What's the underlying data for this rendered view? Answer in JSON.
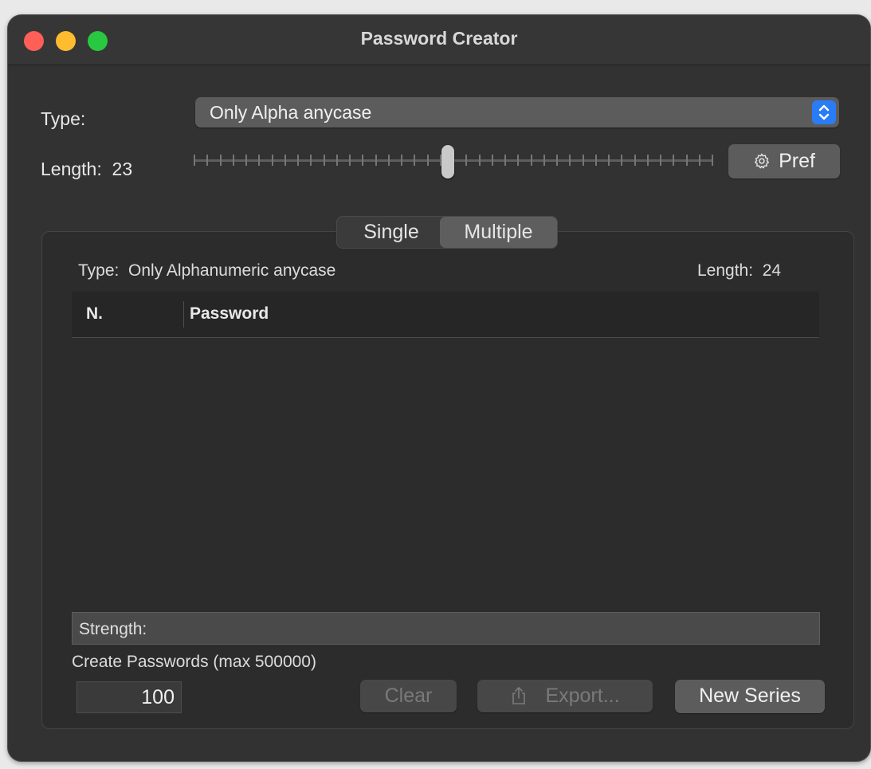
{
  "window": {
    "title": "Password Creator"
  },
  "top": {
    "type_label": "Type:",
    "type_value": "Only Alpha anycase",
    "length_label": "Length:",
    "length_value": "23",
    "pref_button": "Pref"
  },
  "tabs": {
    "single": "Single",
    "multiple": "Multiple",
    "selected": "Multiple"
  },
  "panel": {
    "type_label": "Type:",
    "type_value": "Only Alphanumeric anycase",
    "length_label": "Length:",
    "length_value": "24",
    "table": {
      "columns": [
        "N.",
        "Password"
      ],
      "rows": []
    },
    "strength_label": "Strength:",
    "create_label": "Create Passwords (max 500000)",
    "count_value": "100",
    "clear_button": "Clear",
    "export_button": "Export...",
    "new_series_button": "New Series"
  },
  "icons": {
    "pref": "gear-icon",
    "export": "share-icon",
    "type_popup": "chevron-up-down-icon"
  },
  "colors": {
    "accent": "#2a7cf6",
    "window_bg": "#323232"
  }
}
